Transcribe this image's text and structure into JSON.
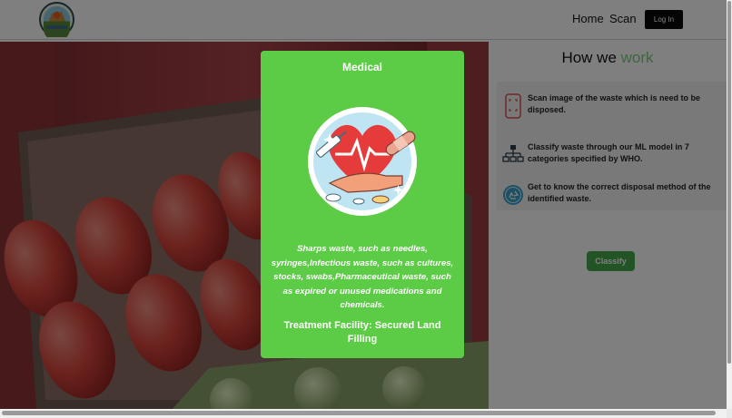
{
  "nav": {
    "home_label": "Home",
    "scan_label": "Scan",
    "login_label": "Log In",
    "logo_icon": "waste-logo-icon"
  },
  "how_we_work": {
    "title_main": "How we",
    "title_accent": "work",
    "accent_color": "#7ccc80",
    "steps": [
      {
        "icon": "phone-scan-icon",
        "text": "Scan image of the waste which is need to be disposed."
      },
      {
        "icon": "hierarchy-icon",
        "text": "Classify waste through our ML model in 7 categories specified by WHO."
      },
      {
        "icon": "recycle-icon",
        "text": "Get to know the correct disposal method of the identified waste."
      }
    ],
    "classify_label": "Classify",
    "classify_color": "#47a94d"
  },
  "modal": {
    "title": "Medical",
    "image_icon": "medical-heart-icon",
    "description": "Sharps waste, such as needles, syringes,Infectious waste, such as cultures, stocks, swabs,Pharmaceutical waste, such as expired or unused medications and chemicals.",
    "facility": "Treatment Facility: Secured Land Filling",
    "background_color": "#5ccb45"
  }
}
